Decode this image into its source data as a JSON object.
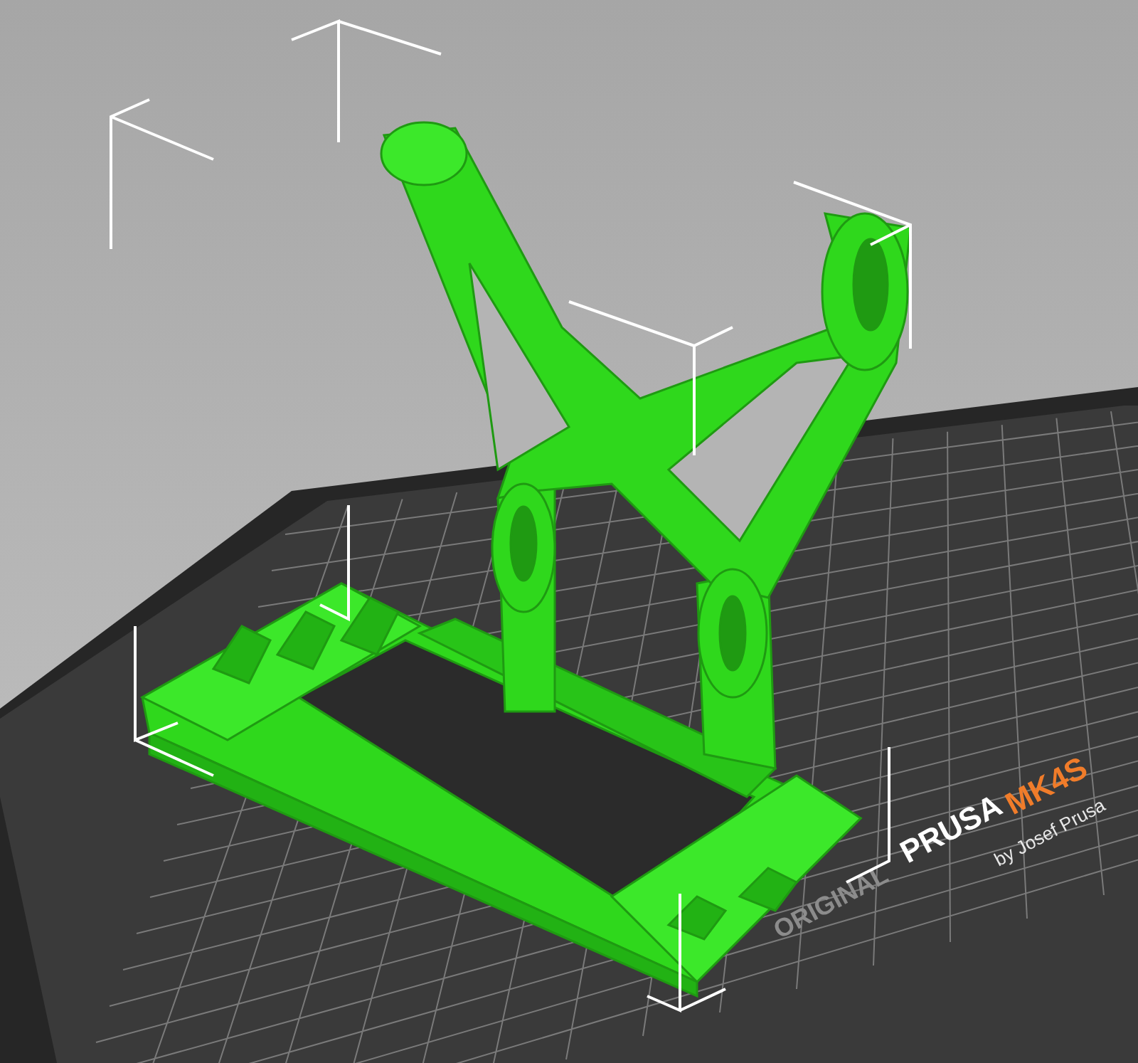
{
  "viewport": {
    "bed": {
      "logo": [
        {
          "text": "ORIGINAL",
          "color": "#8c8c8c"
        },
        {
          "text": "PRUSA",
          "color": "#ffffff"
        },
        {
          "text": "MK4S",
          "color": "#f07c2a"
        },
        {
          "text": "by Josef Prusa",
          "color": "#e8e8e8"
        }
      ]
    }
  }
}
